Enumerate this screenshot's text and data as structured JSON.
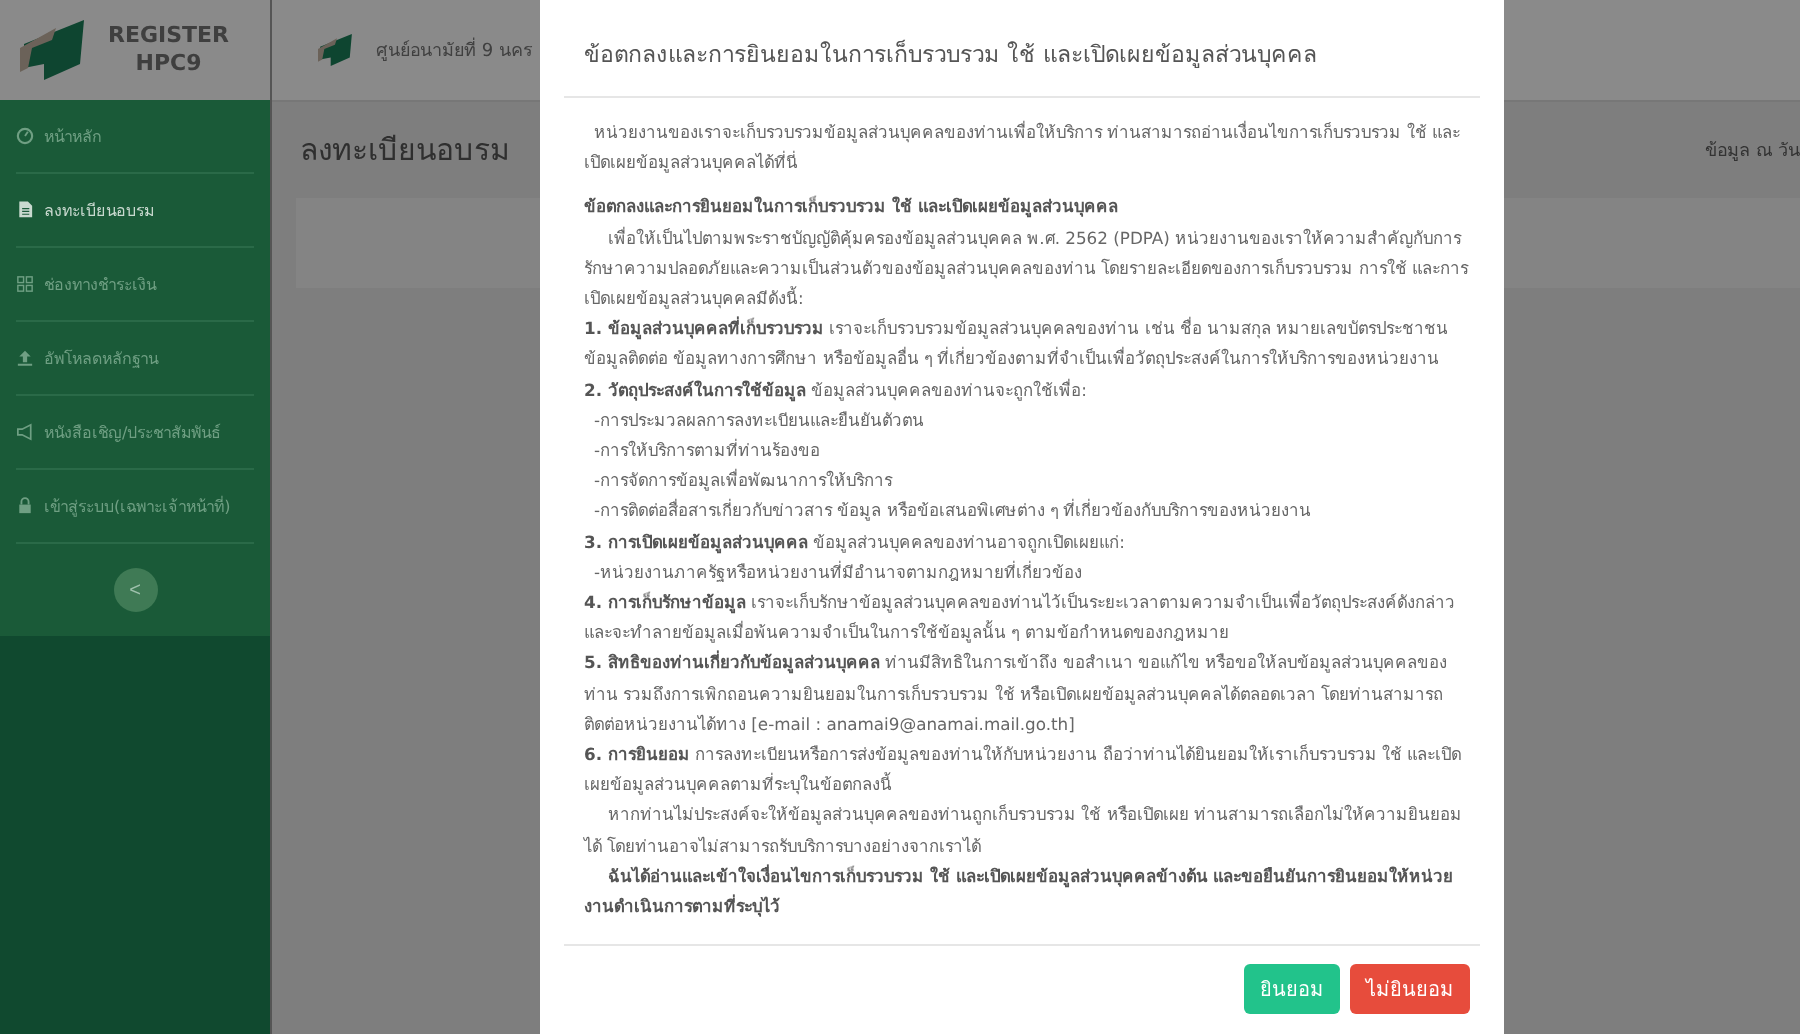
{
  "sidebar": {
    "brand": [
      "REGISTER",
      "HPC9"
    ],
    "items": [
      {
        "label": "หน้าหลัก",
        "selected": false
      },
      {
        "label": "ลงทะเบียนอบรม",
        "selected": true
      },
      {
        "label": "ช่องทางชำระเงิน",
        "selected": false
      },
      {
        "label": "อัพโหลดหลักฐาน",
        "selected": false
      },
      {
        "label": "หนังสือเชิญ/ประชาสัมพันธ์",
        "selected": false
      },
      {
        "label": "เข้าสู่ระบบ(เฉพาะเจ้าหน้าที่)",
        "selected": false
      }
    ],
    "collapse_button": "<"
  },
  "header": {
    "breadcrumb": "ศูนย์อนามัยที่ 9 นคร"
  },
  "page": {
    "title": "ลงทะเบียนอบรม",
    "info": "ข้อมูล ณ วัน"
  },
  "modal": {
    "title": "ข้อตกลงและการยินยอมในการเก็บรวบรวม ใช้ และเปิดเผยข้อมูลส่วนบุคคล",
    "paragraphs": [
      {
        "kind": "lead",
        "text": "หน่วยงานของเราจะเก็บรวบรวมข้อมูลส่วนบุคคลของท่านเพื่อให้บริการ ท่านสามารถอ่านเงื่อนไขการเก็บรวบรวม ใช้ และเปิดเผยข้อมูลส่วนบุคคลได้ที่นี่"
      },
      {
        "kind": "heading",
        "text": "ข้อตกลงและการยินยอมในการเก็บรวบรวม ใช้ และเปิดเผยข้อมูลส่วนบุคคล"
      },
      {
        "kind": "indent",
        "text": "เพื่อให้เป็นไปตามพระราชบัญญัติคุ้มครองข้อมูลส่วนบุคคล พ.ศ. 2562 (PDPA) หน่วยงานของเราให้ความสำคัญกับการรักษาความปลอดภัยและความเป็นส่วนตัวของข้อมูลส่วนบุคคลของท่าน โดยรายละเอียดของการเก็บรวบรวม การใช้ และการเปิดเผยข้อมูลส่วนบุคคลมีดังนี้:"
      },
      {
        "kind": "item",
        "text": "**1. ข้อมูลส่วนบุคคลที่เก็บรวบรวม** เราจะเก็บรวบรวมข้อมูลส่วนบุคคลของท่าน เช่น ชื่อ นามสกุล หมายเลขบัตรประชาชน ข้อมูลติดต่อ ข้อมูลทางการศึกษา หรือข้อมูลอื่น ๆ ที่เกี่ยวข้องตามที่จำเป็นเพื่อวัตถุประสงค์ในการให้บริการของหน่วยงาน"
      },
      {
        "kind": "item",
        "text": "**2. วัตถุประสงค์ในการใช้ข้อมูล** ข้อมูลส่วนบุคคลของท่านจะถูกใช้เพื่อ:"
      },
      {
        "kind": "bullet",
        "text": "-การประมวลผลการลงทะเบียนและยืนยันตัวตน"
      },
      {
        "kind": "bullet",
        "text": "-การให้บริการตามที่ท่านร้องขอ"
      },
      {
        "kind": "bullet",
        "text": "-การจัดการข้อมูลเพื่อพัฒนาการให้บริการ"
      },
      {
        "kind": "bullet",
        "text": "-การติดต่อสื่อสารเกี่ยวกับข่าวสาร ข้อมูล หรือข้อเสนอพิเศษต่าง ๆ ที่เกี่ยวข้องกับบริการของหน่วยงาน"
      },
      {
        "kind": "item",
        "text": "**3. การเปิดเผยข้อมูลส่วนบุคคล** ข้อมูลส่วนบุคคลของท่านอาจถูกเปิดเผยแก่:"
      },
      {
        "kind": "bullet",
        "text": "-หน่วยงานภาครัฐหรือหน่วยงานที่มีอำนาจตามกฎหมายที่เกี่ยวข้อง"
      },
      {
        "kind": "item",
        "text": "**4. การเก็บรักษาข้อมูล** เราจะเก็บรักษาข้อมูลส่วนบุคคลของท่านไว้เป็นระยะเวลาตามความจำเป็นเพื่อวัตถุประสงค์ดังกล่าว และจะทำลายข้อมูลเมื่อพ้นความจำเป็นในการใช้ข้อมูลนั้น ๆ ตามข้อกำหนดของกฎหมาย"
      },
      {
        "kind": "item",
        "text": "**5. สิทธิของท่านเกี่ยวกับข้อมูลส่วนบุคคล** ท่านมีสิทธิในการเข้าถึง ขอสำเนา ขอแก้ไข หรือขอให้ลบข้อมูลส่วนบุคคลของท่าน รวมถึงการเพิกถอนความยินยอมในการเก็บรวบรวม ใช้ หรือเปิดเผยข้อมูลส่วนบุคคลได้ตลอดเวลา โดยท่านสามารถติดต่อหน่วยงานได้ทาง [e-mail : anamai9@anamai.mail.go.th]"
      },
      {
        "kind": "item",
        "text": "**6. การยินยอม** การลงทะเบียนหรือการส่งข้อมูลของท่านให้กับหน่วยงาน ถือว่าท่านได้ยินยอมให้เราเก็บรวบรวม ใช้ และเปิดเผยข้อมูลส่วนบุคคลตามที่ระบุในข้อตกลงนี้"
      },
      {
        "kind": "indent",
        "text": "หากท่านไม่ประสงค์จะให้ข้อมูลส่วนบุคคลของท่านถูกเก็บรวบรวม ใช้ หรือเปิดเผย ท่านสามารถเลือกไม่ให้ความยินยอมได้ โดยท่านอาจไม่สามารถรับบริการบางอย่างจากเราได้"
      },
      {
        "kind": "statement",
        "text": "ฉันได้อ่านและเข้าใจเงื่อนไขการเก็บรวบรวม ใช้ และเปิดเผยข้อมูลส่วนบุคคลข้างต้น และขอยืนยันการยินยอมให้หน่วยงานดำเนินการตามที่ระบุไว้"
      }
    ],
    "buttons": [
      {
        "label": "ยินยอม",
        "kind": "accept"
      },
      {
        "label": "ไม่ยินยอม",
        "kind": "decline"
      }
    ]
  }
}
